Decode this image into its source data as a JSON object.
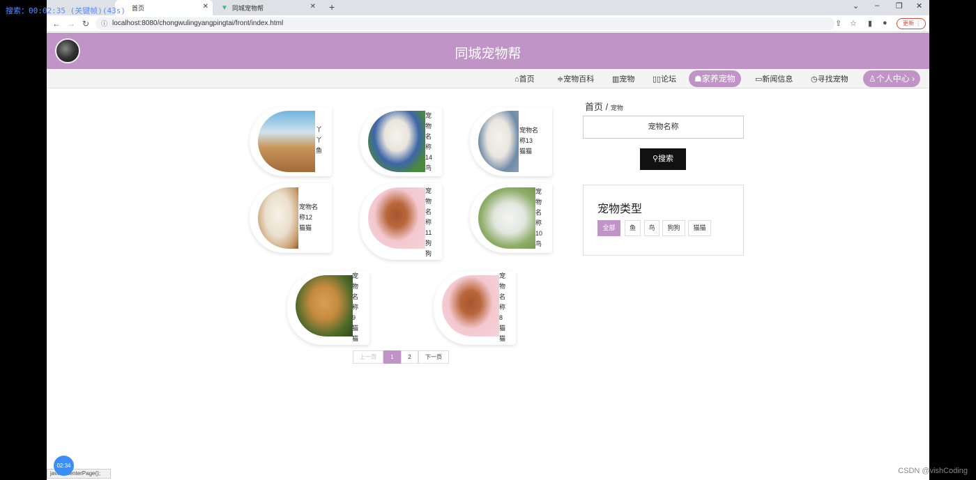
{
  "overlay": {
    "search_timer": "搜索：00:02:35 (关键帧)(43s)"
  },
  "browser": {
    "tabs": [
      {
        "label": "首页"
      },
      {
        "label": "同城宠物帮"
      }
    ],
    "url": "localhost:8080/chongwulingyangpingtai/front/index.html",
    "update_label": "更新",
    "status_text": "java...:centerPage();"
  },
  "site": {
    "title": "同城宠物帮",
    "nav": [
      {
        "icon": "home-icon",
        "label": "首页"
      },
      {
        "icon": "list-icon",
        "label": "宠物百科"
      },
      {
        "icon": "pet-icon",
        "label": "宠物"
      },
      {
        "icon": "forum-icon",
        "label": "论坛"
      },
      {
        "icon": "adopt-icon",
        "label": "家养宠物",
        "active": true
      },
      {
        "icon": "news-icon",
        "label": "新闻信息"
      },
      {
        "icon": "find-icon",
        "label": "寻找宠物"
      },
      {
        "icon": "user-icon",
        "label": "个人中心",
        "active": true
      }
    ]
  },
  "pets": [
    {
      "lines": [
        "丫",
        "丫",
        "鱼"
      ]
    },
    {
      "lines": [
        "宠",
        "物",
        "名",
        "称",
        "14",
        "鸟"
      ]
    },
    {
      "lines": [
        "宠物名",
        "称13",
        "猫猫"
      ]
    },
    {
      "lines": [
        "宠物名",
        "称12",
        "猫猫"
      ]
    },
    {
      "lines": [
        "宠",
        "物",
        "名",
        "称",
        "11",
        "狗",
        "狗"
      ]
    },
    {
      "lines": [
        "宠",
        "物",
        "名",
        "称",
        "10",
        "鸟"
      ]
    },
    {
      "lines": [
        "宠",
        "物",
        "名",
        "称",
        "9",
        "猫",
        "猫"
      ]
    },
    {
      "lines": [
        "宠",
        "物",
        "名",
        "称",
        "8",
        "猫",
        "猫"
      ]
    }
  ],
  "sidebar": {
    "breadcrumb_home": "首页",
    "breadcrumb_sep": "/",
    "breadcrumb_current": "宠物",
    "search_placeholder": "宠物名称",
    "search_button": "搜索",
    "type_title": "宠物类型",
    "types": [
      "全部",
      "鱼",
      "鸟",
      "狗狗",
      "猫猫"
    ],
    "selected_type": "全部"
  },
  "pagination": {
    "prev": "上一页",
    "pages": [
      "1",
      "2"
    ],
    "current": "1",
    "next": "下一页"
  },
  "recording": {
    "timer": "02:34"
  },
  "watermark": "CSDN @vishCoding"
}
